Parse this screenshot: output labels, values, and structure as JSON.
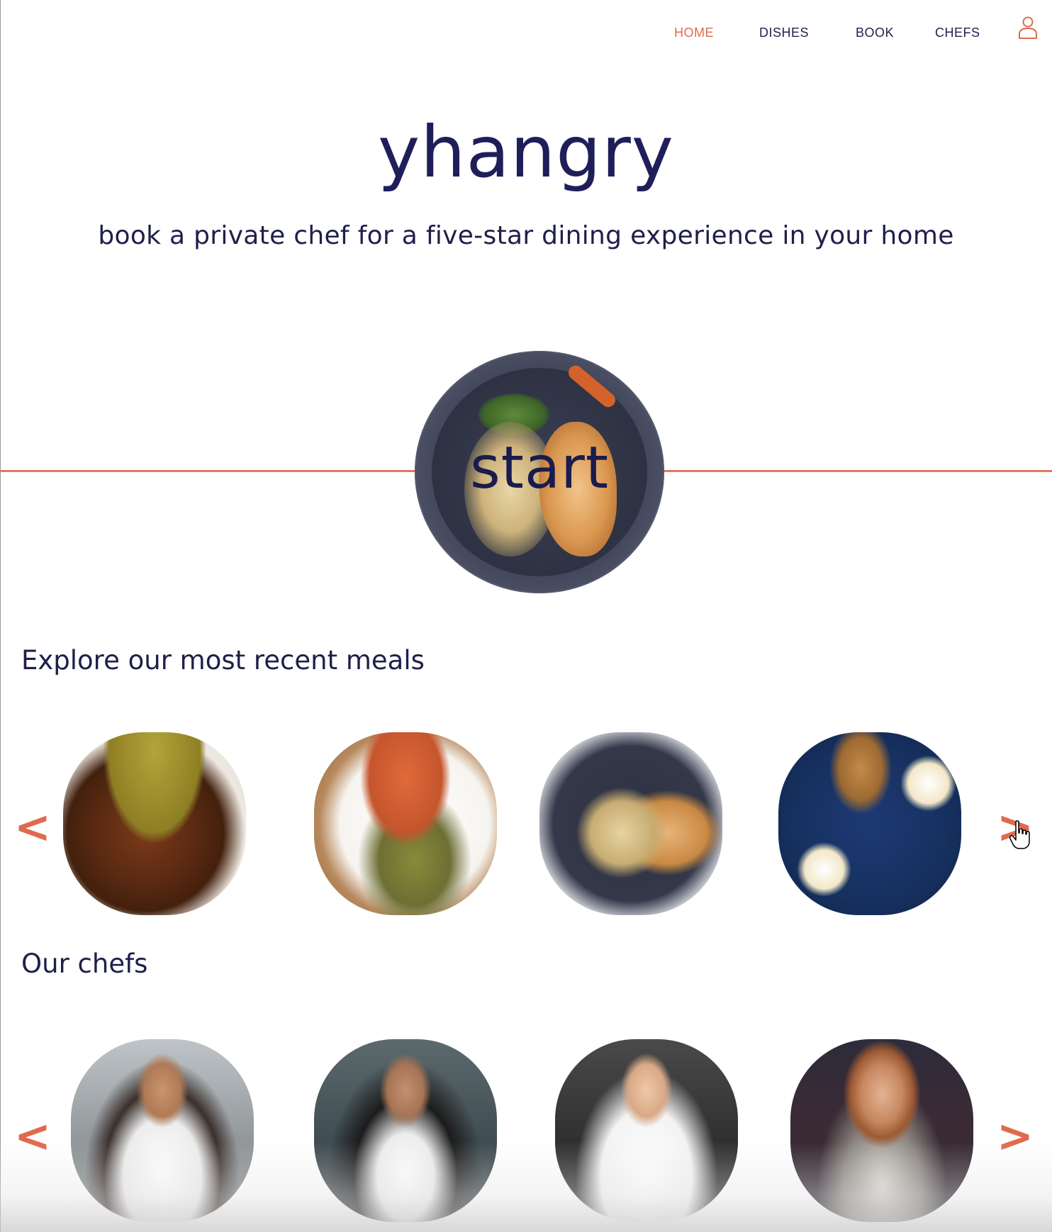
{
  "nav": {
    "items": [
      {
        "label": "HOME",
        "active": true
      },
      {
        "label": "DISHES",
        "active": false
      },
      {
        "label": "BOOK",
        "active": false
      },
      {
        "label": "CHEFS",
        "active": false
      }
    ],
    "user_icon": "user-icon"
  },
  "hero": {
    "brand": "yhangry",
    "tagline": "book a private chef for a five-star dining experience in your home",
    "start_label": "start"
  },
  "meals": {
    "title": "Explore our most recent meals",
    "prev_arrow": "<",
    "next_arrow": ">"
  },
  "chefs": {
    "title": "Our chefs",
    "prev_arrow": "<",
    "next_arrow": ">"
  },
  "colors": {
    "accent": "#e06a4e",
    "brand_navy": "#1e1f5a",
    "text": "#1f1f4a"
  }
}
